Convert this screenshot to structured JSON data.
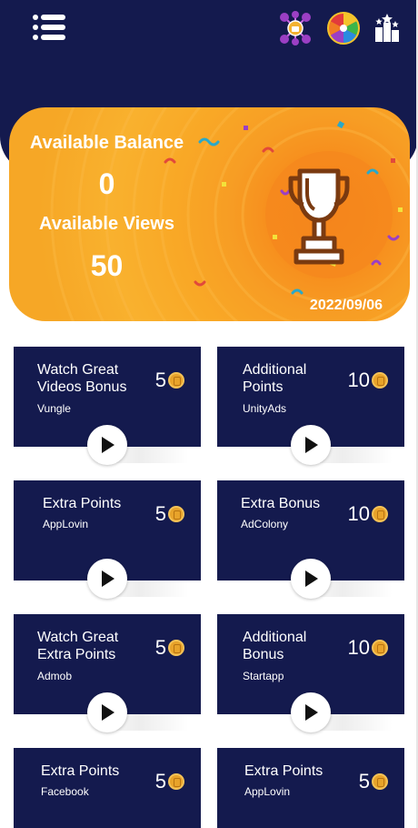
{
  "colors": {
    "header_bg": "#141a4e",
    "card_bg": "#141a4e",
    "balance_card": "#f79d24",
    "coin": "#e8a32a"
  },
  "header": {
    "icons": [
      "menu-icon",
      "money-network-icon",
      "prize-wheel-icon",
      "leaderboard-icon"
    ]
  },
  "balance_card": {
    "balance_label": "Available Balance",
    "balance_value": "0",
    "views_label": "Available Views",
    "views_value": "50",
    "date": "2022/09/06",
    "icon": "trophy-icon"
  },
  "offers": [
    {
      "title_line1": "Watch Great",
      "title_line2": "Videos Bonus",
      "network": "Vungle",
      "points": "5"
    },
    {
      "title_line1": "Additional",
      "title_line2": "Points",
      "network": "UnityAds",
      "points": "10"
    },
    {
      "title_line1": "Extra Points",
      "title_line2": "",
      "network": "AppLovin",
      "points": "5"
    },
    {
      "title_line1": "Extra Bonus",
      "title_line2": "",
      "network": "AdColony",
      "points": "10"
    },
    {
      "title_line1": "Watch Great",
      "title_line2": "Extra Points",
      "network": "Admob",
      "points": "5"
    },
    {
      "title_line1": "Additional",
      "title_line2": "Bonus",
      "network": "Startapp",
      "points": "10"
    },
    {
      "title_line1": "Extra Points",
      "title_line2": "",
      "network": "Facebook",
      "points": "5"
    },
    {
      "title_line1": "Extra Points",
      "title_line2": "",
      "network": "AppLovin",
      "points": "5"
    }
  ]
}
